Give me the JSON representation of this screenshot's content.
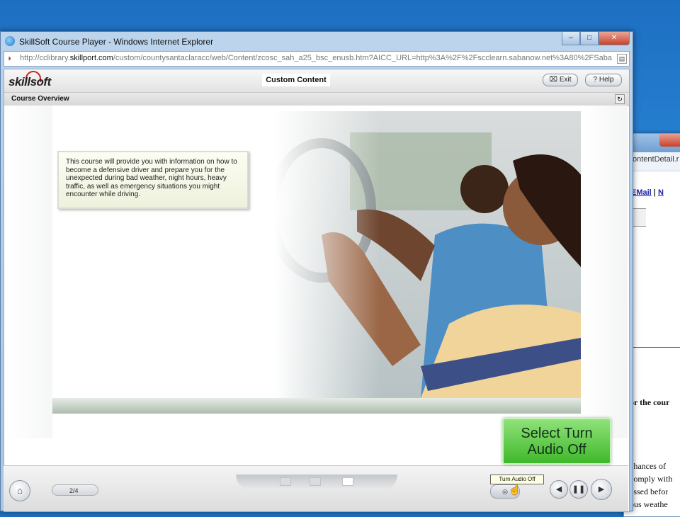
{
  "background_window": {
    "address_fragment": "ontentDetail.r",
    "links": {
      "email": "EMail",
      "separator": "|",
      "next": "N"
    },
    "text_lines": [
      "or the cour",
      "chances of",
      "comply with",
      "essed befor",
      "ous weathe"
    ]
  },
  "browser": {
    "title": "SkillSoft Course Player - Windows Internet Explorer",
    "address_prefix": "http://cclibrary.",
    "address_domain": "skillport.com",
    "address_rest": "/custom/countysantaclaracc/web/Content/zcosc_sah_a25_bsc_enusb.htm?AICC_URL=http%3A%2F%2Fscclearn.sabanow.net%3A80%2FSaba",
    "buttons": {
      "minimize": "–",
      "maximize": "□",
      "close": "✕"
    }
  },
  "player": {
    "logo": "skillsoft",
    "content_title": "Custom Content",
    "exit_label": "Exit",
    "help_label": "Help",
    "section_title": "Course Overview",
    "intro_text": "This course will provide you with information on how to become a defensive driver and prepare you for the unexpected during bad weather, night hours, heavy traffic, as well as emergency situations you might encounter while driving.",
    "page_indicator": "2/4",
    "tooltip": "Turn Audio Off"
  },
  "callout": {
    "line1": "Select Turn",
    "line2": "Audio Off"
  },
  "icons": {
    "home": "⌂",
    "prev": "◀",
    "pause": "❚❚",
    "next": "▶",
    "audio": "◎",
    "exit": "⌧",
    "help": "?"
  },
  "colors": {
    "callout_green": "#3fb82a",
    "tooltip_bg": "#ffffe1",
    "logo_red": "#c8241d"
  }
}
